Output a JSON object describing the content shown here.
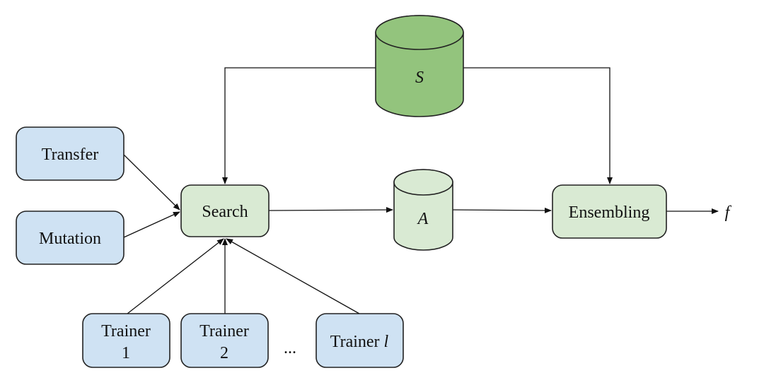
{
  "diagram": {
    "nodes": {
      "transfer": {
        "label": "Transfer",
        "kind": "process",
        "color": "#cfe2f3"
      },
      "mutation": {
        "label": "Mutation",
        "kind": "process",
        "color": "#cfe2f3"
      },
      "search": {
        "label": "Search",
        "kind": "process",
        "color": "#d9ead3"
      },
      "store_s": {
        "label": "S",
        "kind": "datastore",
        "color": "#93c47d"
      },
      "store_a": {
        "label": "A",
        "kind": "datastore",
        "color": "#d9ead3"
      },
      "ensembling": {
        "label": "Ensembling",
        "kind": "process",
        "color": "#d9ead3"
      },
      "trainer1": {
        "line1": "Trainer",
        "line2": "1",
        "kind": "process",
        "color": "#cfe2f3"
      },
      "trainer2": {
        "line1": "Trainer",
        "line2": "2",
        "kind": "process",
        "color": "#cfe2f3"
      },
      "trainerl": {
        "label_prefix": "Trainer ",
        "label_var": "l",
        "kind": "process",
        "color": "#cfe2f3"
      },
      "ellipsis": {
        "label": "..."
      },
      "output": {
        "label": "f"
      }
    },
    "edges": [
      {
        "from": "transfer",
        "to": "search"
      },
      {
        "from": "mutation",
        "to": "search"
      },
      {
        "from": "trainer1",
        "to": "search"
      },
      {
        "from": "trainer2",
        "to": "search"
      },
      {
        "from": "trainerl",
        "to": "search"
      },
      {
        "from": "store_s",
        "to": "search"
      },
      {
        "from": "store_s",
        "to": "ensembling"
      },
      {
        "from": "search",
        "to": "store_a"
      },
      {
        "from": "store_a",
        "to": "ensembling"
      },
      {
        "from": "ensembling",
        "to": "output"
      }
    ]
  }
}
